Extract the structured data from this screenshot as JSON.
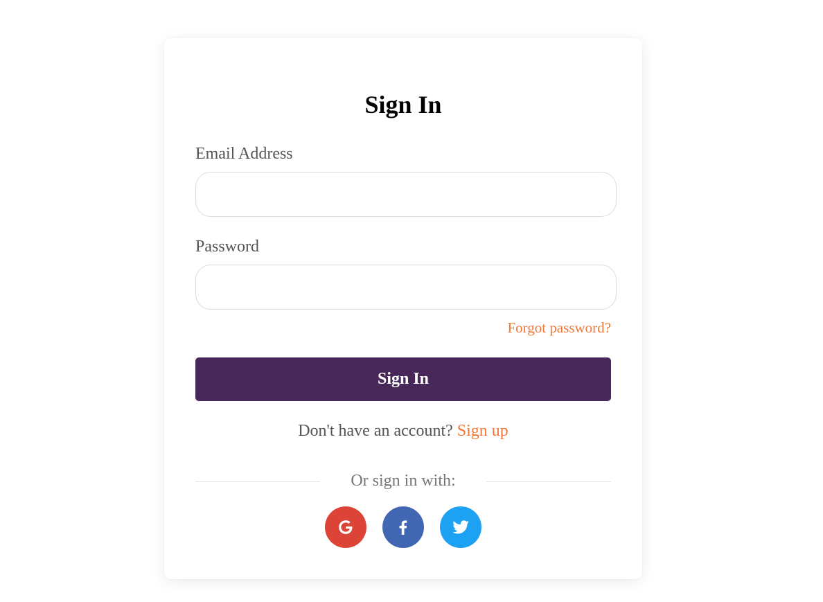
{
  "form": {
    "title": "Sign In",
    "email_label": "Email Address",
    "email_value": "",
    "password_label": "Password",
    "password_value": "",
    "forgot_link": "Forgot password?",
    "submit_label": "Sign In",
    "signup_prompt": "Don't have an account?",
    "signup_link": "Sign up",
    "divider_text": "Or sign in with:"
  },
  "social": [
    {
      "name": "google",
      "icon": "google-icon",
      "color": "#db4437"
    },
    {
      "name": "facebook",
      "icon": "facebook-icon",
      "color": "#4267b2"
    },
    {
      "name": "twitter",
      "icon": "twitter-icon",
      "color": "#1da1f2"
    }
  ],
  "colors": {
    "accent": "#f07838",
    "button": "#482858"
  }
}
